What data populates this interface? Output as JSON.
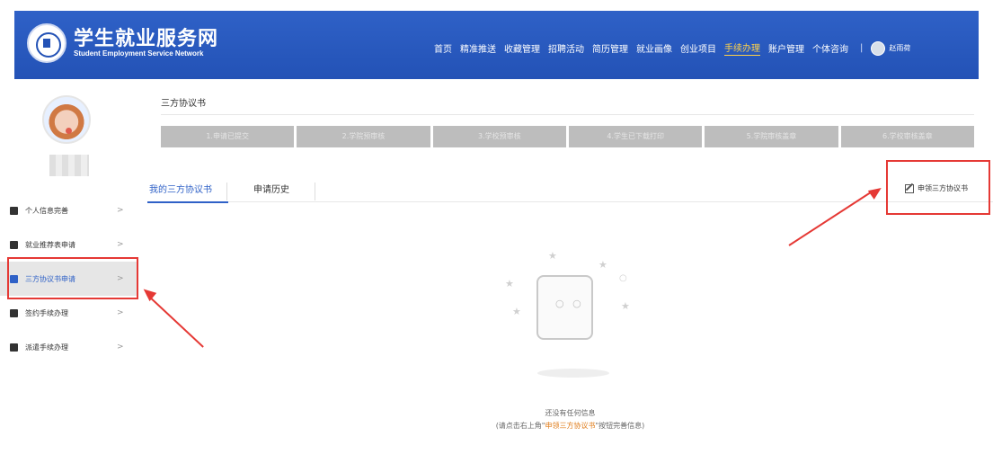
{
  "header": {
    "logo_cn": "学生就业服务网",
    "logo_en": "Student Employment Service Network",
    "nav": [
      {
        "label": "首页"
      },
      {
        "label": "精准推送"
      },
      {
        "label": "收藏管理"
      },
      {
        "label": "招聘活动"
      },
      {
        "label": "简历管理"
      },
      {
        "label": "就业画像"
      },
      {
        "label": "创业项目"
      },
      {
        "label": "手续办理",
        "active": true
      },
      {
        "label": "账户管理"
      },
      {
        "label": "个体咨询"
      }
    ],
    "separator": "|",
    "user_name": "赵雨荷"
  },
  "sidebar": {
    "items": [
      {
        "label": "个人信息完善",
        "icon": "people-icon"
      },
      {
        "label": "就业推荐表申请",
        "icon": "document-icon"
      },
      {
        "label": "三方协议书申请",
        "icon": "document-icon",
        "active": true
      },
      {
        "label": "签约手续办理",
        "icon": "building-icon"
      },
      {
        "label": "派遣手续办理",
        "icon": "card-icon"
      }
    ],
    "chevron": ">"
  },
  "main": {
    "title": "三方协议书",
    "steps": [
      "1.申请已提交",
      "2.学院预审核",
      "3.学校预审核",
      "4.学生已下载打印",
      "5.学院审核盖章",
      "6.学校审核盖章"
    ],
    "tabs": [
      "我的三方协议书",
      "申请历史"
    ],
    "apply_label": "申领三方协议书",
    "empty_message": "还没有任何信息",
    "empty_hint_prefix": "(请点击右上角\"",
    "empty_hint_accent": "申领三方协议书",
    "empty_hint_suffix": "\"按钮完善信息)",
    "face": "○ ○"
  },
  "colors": {
    "brand": "#2f61c7",
    "active_nav": "#ffd24a",
    "annotation": "#e53935",
    "hint_accent": "#e07d1b"
  }
}
